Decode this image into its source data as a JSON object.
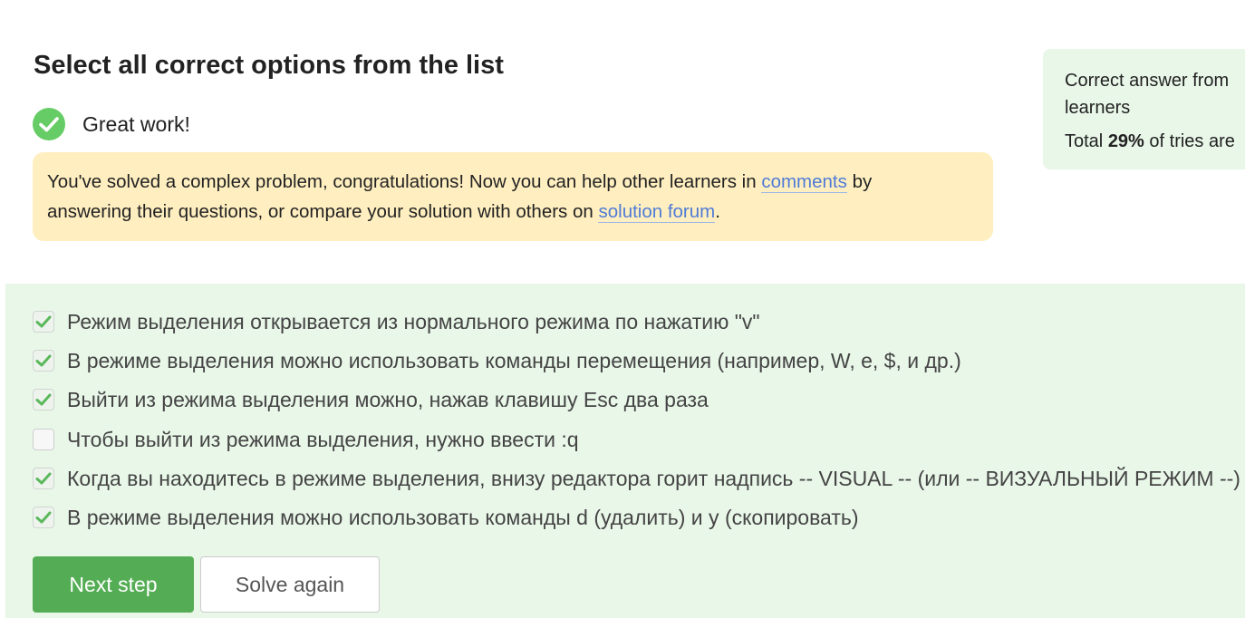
{
  "step": {
    "title": "Select all correct options from the list",
    "result_text": "Great work!",
    "notice": {
      "text_1": "You've solved a complex problem, congratulations! Now you can help other learners in ",
      "comments_link": "comments",
      "text_2": " by",
      "text_3": "answering their questions, or compare your solution with others on ",
      "forum_link": "solution forum",
      "text_4": "."
    }
  },
  "stats": {
    "line_1": "Correct answer from",
    "line_2": "learners",
    "total_prefix": "Total ",
    "total_percent": "29%",
    "total_suffix": " of tries are"
  },
  "options": [
    {
      "text": "Режим выделения открывается из нормального режима по нажатию \"v\"",
      "checked": true
    },
    {
      "text": "В режиме выделения можно использовать команды перемещения (например, W, e, $, и др.)",
      "checked": true
    },
    {
      "text": "Выйти из режима выделения можно, нажав клавишу Esc два раза",
      "checked": true
    },
    {
      "text": "Чтобы выйти из режима выделения, нужно ввести :q",
      "checked": false
    },
    {
      "text": "Когда вы находитесь в режиме выделения, внизу редактора горит надпись -- VISUAL -- (или -- ВИЗУАЛЬНЫЙ РЕЖИМ --)",
      "checked": true
    },
    {
      "text": "В режиме выделения можно использовать команды d (удалить) и y (скопировать)",
      "checked": true
    }
  ],
  "buttons": {
    "next": "Next step",
    "solve_again": "Solve again"
  },
  "colors": {
    "success_green": "#66cc66",
    "button_green": "#54ad54",
    "answers_bg": "#e9f7e9",
    "notice_bg": "#ffefc0",
    "link_blue": "#4f7bd6",
    "checkmark_green": "#5bb85b"
  }
}
